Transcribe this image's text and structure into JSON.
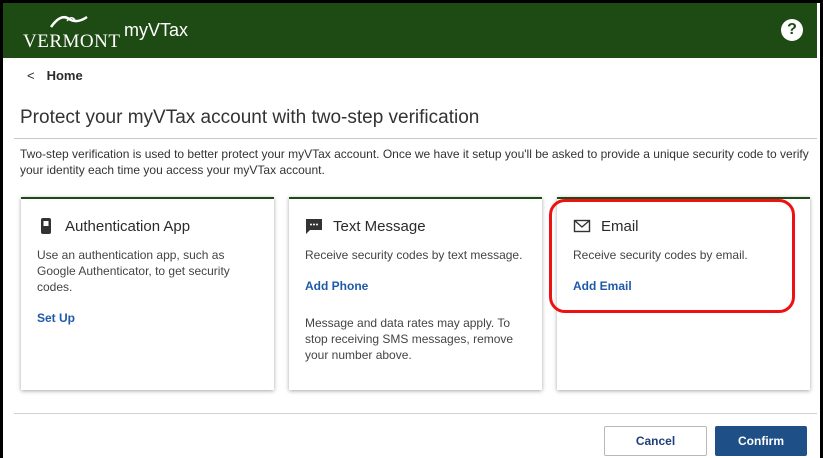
{
  "header": {
    "logo_text": "VERMONT",
    "app_name": "myVTax",
    "help_icon": "question-circle-icon",
    "help_glyph": "?"
  },
  "nav": {
    "back_glyph": "<",
    "home_label": "Home"
  },
  "page": {
    "title": "Protect your myVTax account with two-step verification",
    "intro": "Two-step verification is used to better protect your myVTax account. Once we have it setup you'll be asked to provide a unique security code to verify your identity each time you access your myVTax account."
  },
  "options": [
    {
      "icon": "smartphone-icon",
      "title": "Authentication App",
      "description": "Use an authentication app, such as Google Authenticator, to get security codes.",
      "action": "Set Up",
      "note": ""
    },
    {
      "icon": "chat-bubble-icon",
      "title": "Text Message",
      "description": "Receive security codes by text message.",
      "action": "Add Phone",
      "note": "Message and data rates may apply. To stop receiving SMS messages, remove your number above."
    },
    {
      "icon": "envelope-icon",
      "title": "Email",
      "description": "Receive security codes by email.",
      "action": "Add Email",
      "note": ""
    }
  ],
  "footer": {
    "cancel_label": "Cancel",
    "confirm_label": "Confirm"
  },
  "colors": {
    "header_bg": "#1e4a14",
    "link": "#1f5aa8",
    "confirm_bg": "#1f4f87",
    "highlight": "#e11111"
  }
}
